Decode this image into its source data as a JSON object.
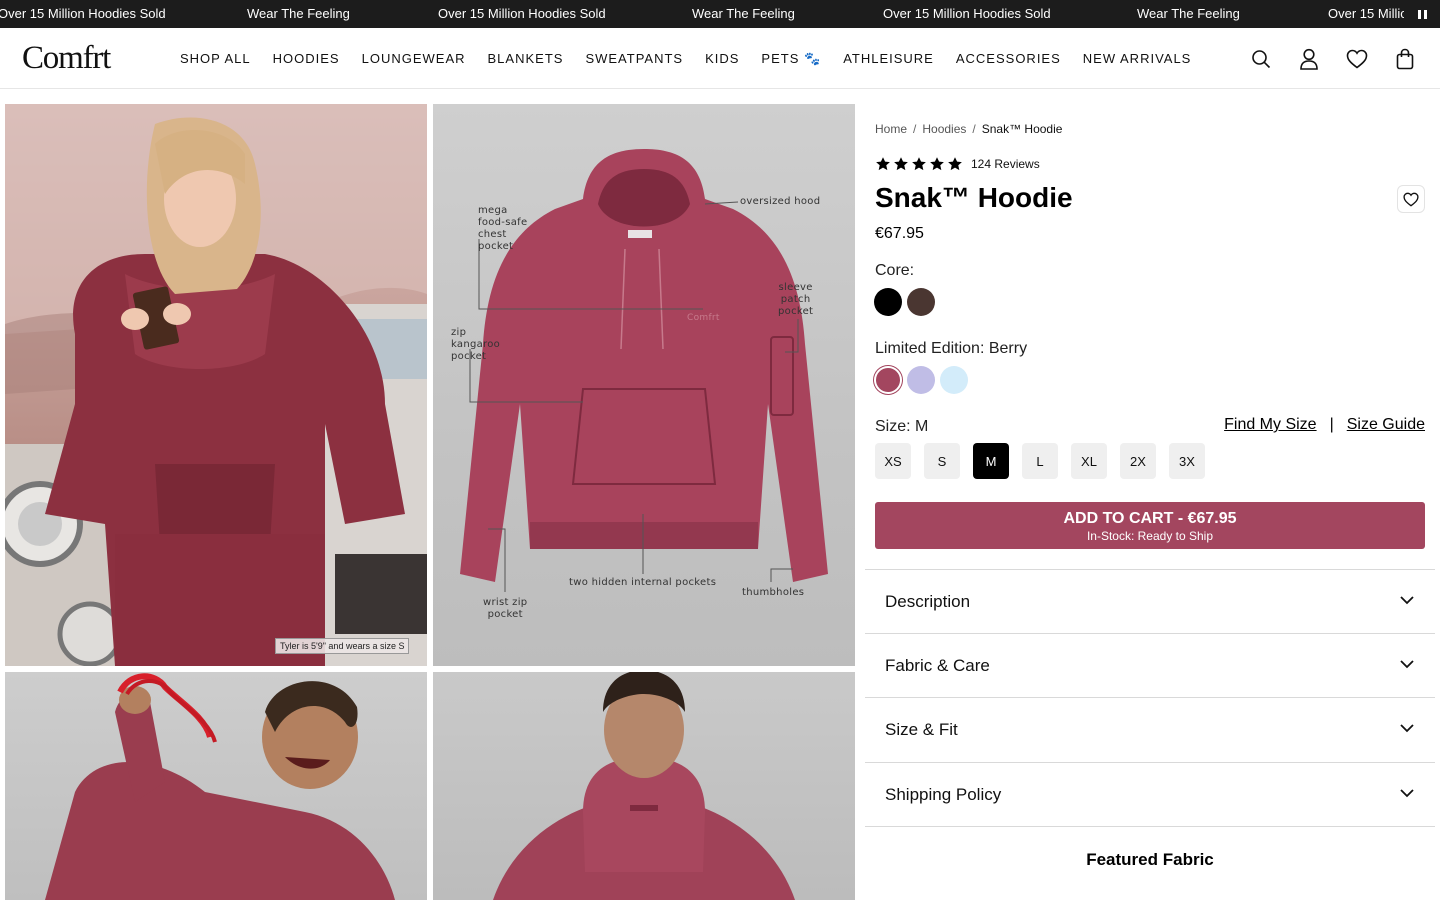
{
  "announcement": {
    "messages": [
      "Over 15 Million Hoodies Sold",
      "Wear The Feeling",
      "Over 15 Million Hoodies Sold",
      "Wear The Feeling",
      "Over 15 Million Hoodies Sold",
      "Wear The Feeling",
      "Over 15 Millio"
    ],
    "pause_icon": "pause-icon"
  },
  "header": {
    "logo": "Comfrt",
    "nav": [
      "SHOP ALL",
      "HOODIES",
      "LOUNGEWEAR",
      "BLANKETS",
      "SWEATPANTS",
      "KIDS",
      "PETS 🐾",
      "ATHLEISURE",
      "ACCESSORIES",
      "NEW ARRIVALS"
    ],
    "icons": [
      "search-icon",
      "account-icon",
      "wishlist-icon",
      "cart-icon"
    ]
  },
  "gallery": {
    "model_caption": "Tyler is 5'9\" and wears a size S",
    "annotations": {
      "chest_pocket": [
        "mega",
        "food-safe",
        "chest",
        "pocket"
      ],
      "hood": "oversized hood",
      "sleeve_pocket": [
        "sleeve",
        "patch",
        "pocket"
      ],
      "kangaroo_pocket": [
        "zip",
        "kangaroo",
        "pocket"
      ],
      "internal_pockets": "two hidden internal pockets",
      "thumbholes": "thumbholes",
      "wrist_pocket": [
        "wrist zip",
        "pocket"
      ],
      "chest_logo": "Comfrt"
    }
  },
  "product": {
    "breadcrumb": [
      "Home",
      "/",
      "Hoodies",
      "/",
      "Snak™ Hoodie"
    ],
    "rating": 5,
    "reviews": "124 Reviews",
    "title": "Snak™ Hoodie",
    "price": "€67.95",
    "core_label": "Core:",
    "core_colors": [
      "#000000",
      "#4a3631"
    ],
    "limited_label": "Limited Edition: Berry",
    "limited_colors": [
      "#a3465f",
      "#c0bde6",
      "#d3ecfa"
    ],
    "size_label": "Size: M",
    "find_size": "Find My Size",
    "separator": "|",
    "size_guide": "Size Guide",
    "sizes": [
      "XS",
      "S",
      "M",
      "L",
      "XL",
      "2X",
      "3X"
    ],
    "selected_size": "M",
    "add_to_cart": "ADD TO CART - €67.95",
    "stock": "In-Stock: Ready to Ship",
    "accordions": [
      "Description",
      "Fabric & Care",
      "Size & Fit",
      "Shipping Policy"
    ],
    "featured": "Featured Fabric"
  },
  "colors": {
    "brand_berry": "#a3465f",
    "announcement_bg": "#1c1c1c"
  }
}
